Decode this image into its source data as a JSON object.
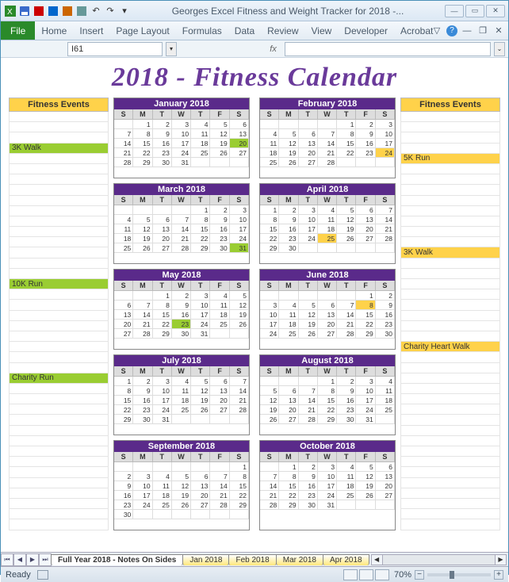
{
  "titlebar": {
    "doc": "Georges Excel Fitness and Weight Tracker for 2018 -..."
  },
  "ribbon": {
    "file": "File",
    "tabs": [
      "Home",
      "Insert",
      "Page Layout",
      "Formulas",
      "Data",
      "Review",
      "View",
      "Developer",
      "Acrobat"
    ]
  },
  "namebox": "I61",
  "fx_label": "fx",
  "page_title": "2018 - Fitness Calendar",
  "side_head": "Fitness Events",
  "left_events": [
    {
      "row": 3,
      "label": "3K Walk",
      "cls": "g"
    },
    {
      "row": 16,
      "label": "10K Run",
      "cls": "g"
    },
    {
      "row": 25,
      "label": "Charity Run",
      "cls": "g"
    }
  ],
  "right_events": [
    {
      "row": 4,
      "label": "5K Run",
      "cls": "y"
    },
    {
      "row": 13,
      "label": "3K Walk",
      "cls": "y"
    },
    {
      "row": 22,
      "label": "Charity Heart Walk",
      "cls": "y"
    }
  ],
  "dow": [
    "S",
    "M",
    "T",
    "W",
    "T",
    "F",
    "S"
  ],
  "months": [
    {
      "name": "January 2018",
      "start": 1,
      "days": 31,
      "hl": [
        {
          "d": 20,
          "c": "g"
        }
      ]
    },
    {
      "name": "February 2018",
      "start": 4,
      "days": 28,
      "hl": [
        {
          "d": 24,
          "c": "y"
        }
      ]
    },
    {
      "name": "March 2018",
      "start": 4,
      "days": 31,
      "hl": [
        {
          "d": 31,
          "c": "g"
        }
      ]
    },
    {
      "name": "April 2018",
      "start": 0,
      "days": 30,
      "hl": [
        {
          "d": 25,
          "c": "y"
        }
      ]
    },
    {
      "name": "May 2018",
      "start": 2,
      "days": 31,
      "hl": [
        {
          "d": 23,
          "c": "g"
        }
      ]
    },
    {
      "name": "June 2018",
      "start": 5,
      "days": 30,
      "hl": [
        {
          "d": 8,
          "c": "y"
        }
      ]
    },
    {
      "name": "July 2018",
      "start": 0,
      "days": 31,
      "hl": []
    },
    {
      "name": "August 2018",
      "start": 3,
      "days": 31,
      "hl": []
    },
    {
      "name": "September 2018",
      "start": 6,
      "days": 30,
      "hl": []
    },
    {
      "name": "October 2018",
      "start": 1,
      "days": 31,
      "hl": []
    }
  ],
  "sheet_tabs": [
    "Full Year 2018 - Notes On Sides",
    "Jan 2018",
    "Feb 2018",
    "Mar 2018",
    "Apr 2018"
  ],
  "status": {
    "ready": "Ready",
    "zoom": "70%"
  }
}
